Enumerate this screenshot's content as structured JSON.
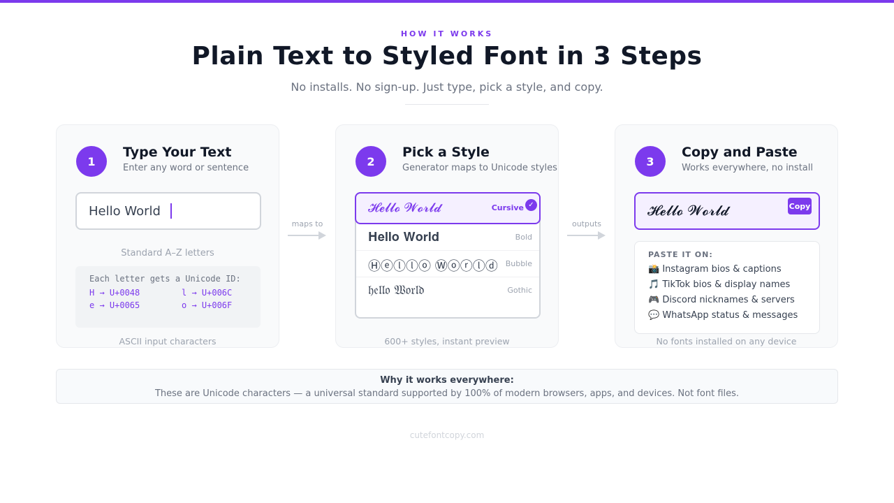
{
  "header": {
    "eyebrow": "HOW IT WORKS",
    "title": "Plain Text to Styled Font in 3 Steps",
    "subtitle": "No installs. No sign-up. Just type, pick a style, and copy."
  },
  "colors": {
    "accent": "#7c3aed",
    "text": "#111827",
    "muted": "#6b7280"
  },
  "steps": [
    {
      "number": "1",
      "title": "Type Your Text",
      "subtitle": "Enter any word or sentence",
      "input_value": "Hello World",
      "caption": "Standard A–Z letters",
      "code_title": "Each letter gets a Unicode ID:",
      "codes": [
        "H → U+0048",
        "l → U+006C",
        "e → U+0065",
        "o → U+006F"
      ],
      "footer": "ASCII input characters"
    },
    {
      "number": "2",
      "title": "Pick a Style",
      "subtitle": "Generator maps to Unicode styles",
      "styles": [
        {
          "text": "𝓗𝓮𝓵𝓵𝓸 𝓦𝓸𝓻𝓵𝓭",
          "name": "Cursive",
          "selected": true
        },
        {
          "text": "𝐇𝐞𝐥𝐥𝐨 𝐖𝐨𝐫𝐥𝐝",
          "name": "Bold",
          "selected": false
        },
        {
          "text": "Ⓗⓔⓛⓛⓞ Ⓦⓞⓡⓛⓓ",
          "name": "Bubble",
          "selected": false
        },
        {
          "text": "𝔥𝔢𝔩𝔩𝔬 𝔚𝔬𝔯𝔩𝔡",
          "name": "Gothic",
          "selected": false
        }
      ],
      "check_icon": "✓",
      "footer": "600+ styles, instant preview"
    },
    {
      "number": "3",
      "title": "Copy and Paste",
      "subtitle": "Works everywhere, no install",
      "output_value": "𝓗𝓮𝓵𝓵𝓸 𝓦𝓸𝓻𝓵𝓭",
      "copy_label": "Copy",
      "paste_title": "PASTE IT ON:",
      "paste_items": [
        "📸 Instagram bios & captions",
        "🎵 TikTok bios & display names",
        "🎮 Discord nicknames & servers",
        "💬 WhatsApp status & messages"
      ],
      "footer": "No fonts installed on any device"
    }
  ],
  "arrows": [
    "maps to",
    "outputs"
  ],
  "banner": {
    "title": "Why it works everywhere:",
    "text": "These are Unicode characters — a universal standard supported by 100% of modern browsers, apps, and devices. Not font files."
  },
  "footer": "cutefontcopy.com"
}
